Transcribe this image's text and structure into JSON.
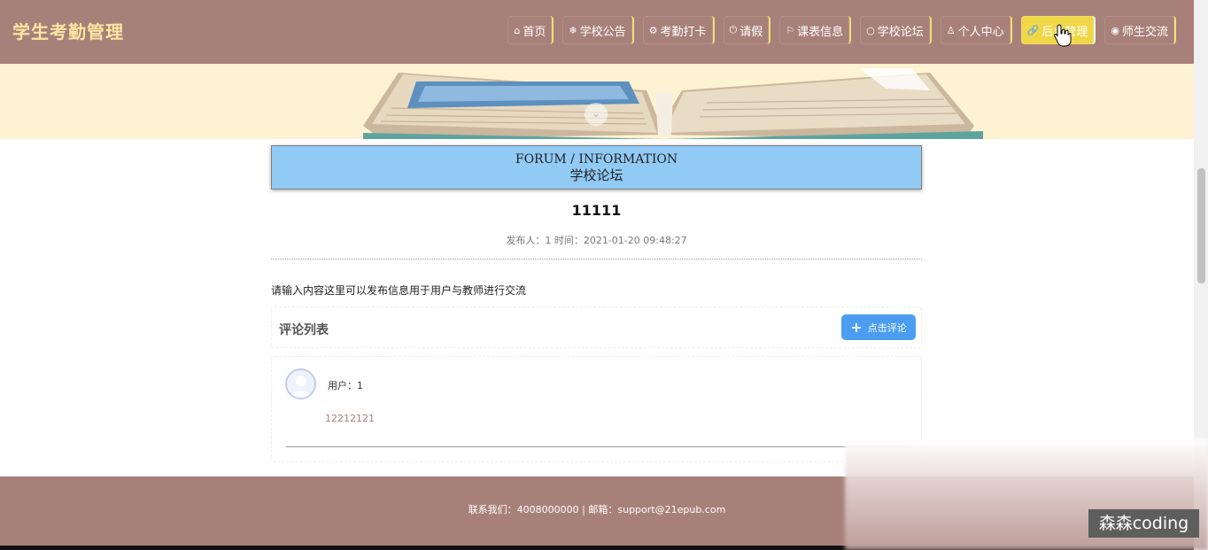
{
  "header": {
    "site_title": "学生考勤管理",
    "nav": [
      {
        "icon": "⌂",
        "label": "首页"
      },
      {
        "icon": "❄",
        "label": "学校公告"
      },
      {
        "icon": "⚙",
        "label": "考勤打卡"
      },
      {
        "icon": "⏻",
        "label": "请假"
      },
      {
        "icon": "⚐",
        "label": "课表信息"
      },
      {
        "icon": "○",
        "label": "学校论坛"
      },
      {
        "icon": "♙",
        "label": "个人中心"
      },
      {
        "icon": "🔗",
        "label": "后台管理"
      },
      {
        "icon": "◉",
        "label": "师生交流"
      }
    ],
    "active_index": 7
  },
  "forum": {
    "title_en": "FORUM / INFORMATION",
    "title_cn": "学校论坛"
  },
  "post": {
    "title": "11111",
    "meta": "发布人：1 时间：2021-01-20 09:48:27",
    "content": "请输入内容这里可以发布信息用于用户与教师进行交流"
  },
  "comments": {
    "list_title": "评论列表",
    "add_button_label": "点击评论",
    "items": [
      {
        "user": "用户：1",
        "text": "12212121"
      }
    ]
  },
  "footer": {
    "contact": "联系我们：4008000000 | 邮箱：support@21epub.com"
  },
  "watermark": "森森coding",
  "colors": {
    "brand": "#a8807a",
    "title_yellow": "#fde5a2",
    "active_nav": "#f0d748",
    "forum_box": "#91caf5",
    "button_blue": "#4a9df1"
  }
}
